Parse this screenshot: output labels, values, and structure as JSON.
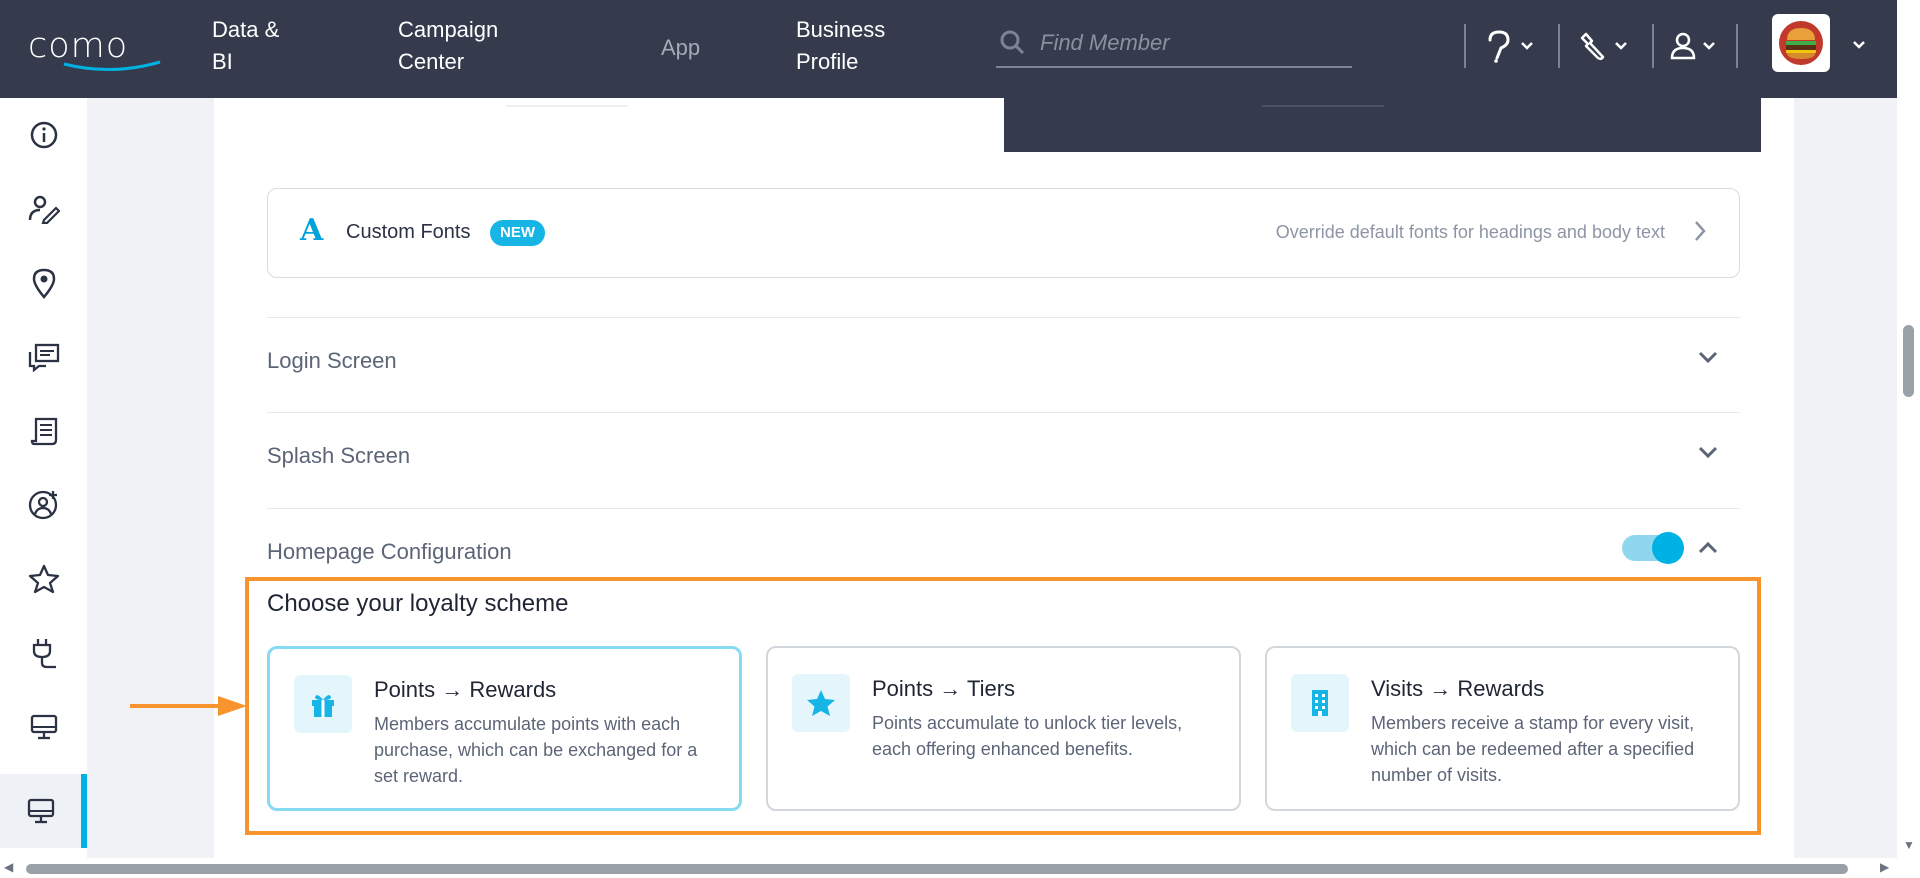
{
  "topbar": {
    "logo_text": "como",
    "nav": [
      {
        "line1": "Data &",
        "line2": "BI"
      },
      {
        "line1": "Campaign",
        "line2": "Center"
      },
      {
        "label": "App"
      },
      {
        "line1": "Business",
        "line2": "Profile"
      }
    ],
    "search_placeholder": "Find Member",
    "icons": [
      "help-icon",
      "tools-icon",
      "user-icon"
    ]
  },
  "sidebar": {
    "items": [
      "info-icon",
      "user-edit-icon",
      "location-pin-icon",
      "chat-board-icon",
      "receipt-icon",
      "user-add-icon",
      "star-icon",
      "plug-icon",
      "monitor-icon",
      "monitor-icon-active"
    ]
  },
  "custom_fonts": {
    "icon_letter": "A",
    "title": "Custom Fonts",
    "badge": "NEW",
    "description": "Override default fonts for headings and body text"
  },
  "sections": [
    {
      "title": "Login Screen"
    },
    {
      "title": "Splash Screen"
    },
    {
      "title": "Homepage Configuration",
      "toggle_on": true
    }
  ],
  "loyalty": {
    "title": "Choose your loyalty scheme",
    "schemes": [
      {
        "icon": "gift-icon",
        "title": "Points → Rewards",
        "description": "Members accumulate points with each purchase, which can be exchanged for a set reward.",
        "selected": true
      },
      {
        "icon": "star-icon",
        "title": "Points → Tiers",
        "description": "Points accumulate to unlock tier levels, each offering enhanced benefits.",
        "selected": false
      },
      {
        "icon": "building-icon",
        "title": "Visits → Rewards",
        "description": "Members receive a stamp for every visit, which can be redeemed after a specified number of visits.",
        "selected": false
      }
    ]
  },
  "colors": {
    "topbar": "#353b4c",
    "accent": "#00b2e3",
    "highlight": "#f7942e"
  }
}
